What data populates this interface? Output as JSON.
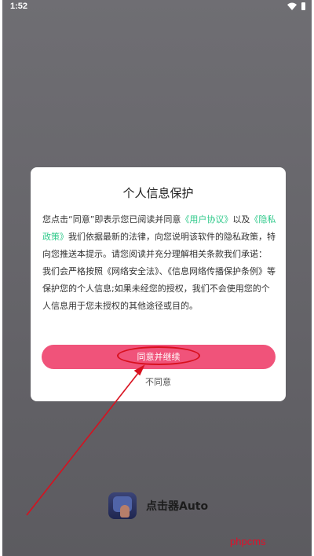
{
  "status_bar": {
    "time": "1:52",
    "wifi_icon": "wifi-icon",
    "battery_icon": "battery-icon"
  },
  "dialog": {
    "title": "个人信息保护",
    "body_part1": "您点击“同意”即表示您已阅读并同意",
    "user_agreement_link": "《用户协议》",
    "body_part2": "以及",
    "privacy_policy_link": "《隐私政策》",
    "body_part3": "我们依据最新的法律，向您说明该软件的隐私政策，特向您推送本提示。请您阅读并充分理解相关条款我们承诺：",
    "body_part4": "我们会严格按照《网络安全法》、《信息网络传播保护条例》等保护您的个人信息;如果未经您的授权，我们不会使用您的个人信息用于您未授权的其他途径或目的。",
    "agree_label": "同意并继续",
    "disagree_label": "不同意",
    "accent_color": "#f0537a",
    "link_color": "#2ec98a"
  },
  "app": {
    "name": "点击器Auto",
    "icon": "app-icon"
  },
  "annotation": {
    "ellipse_color": "#d8101e",
    "arrow_color": "#d8101e"
  },
  "watermark": {
    "text": "phpcms"
  }
}
